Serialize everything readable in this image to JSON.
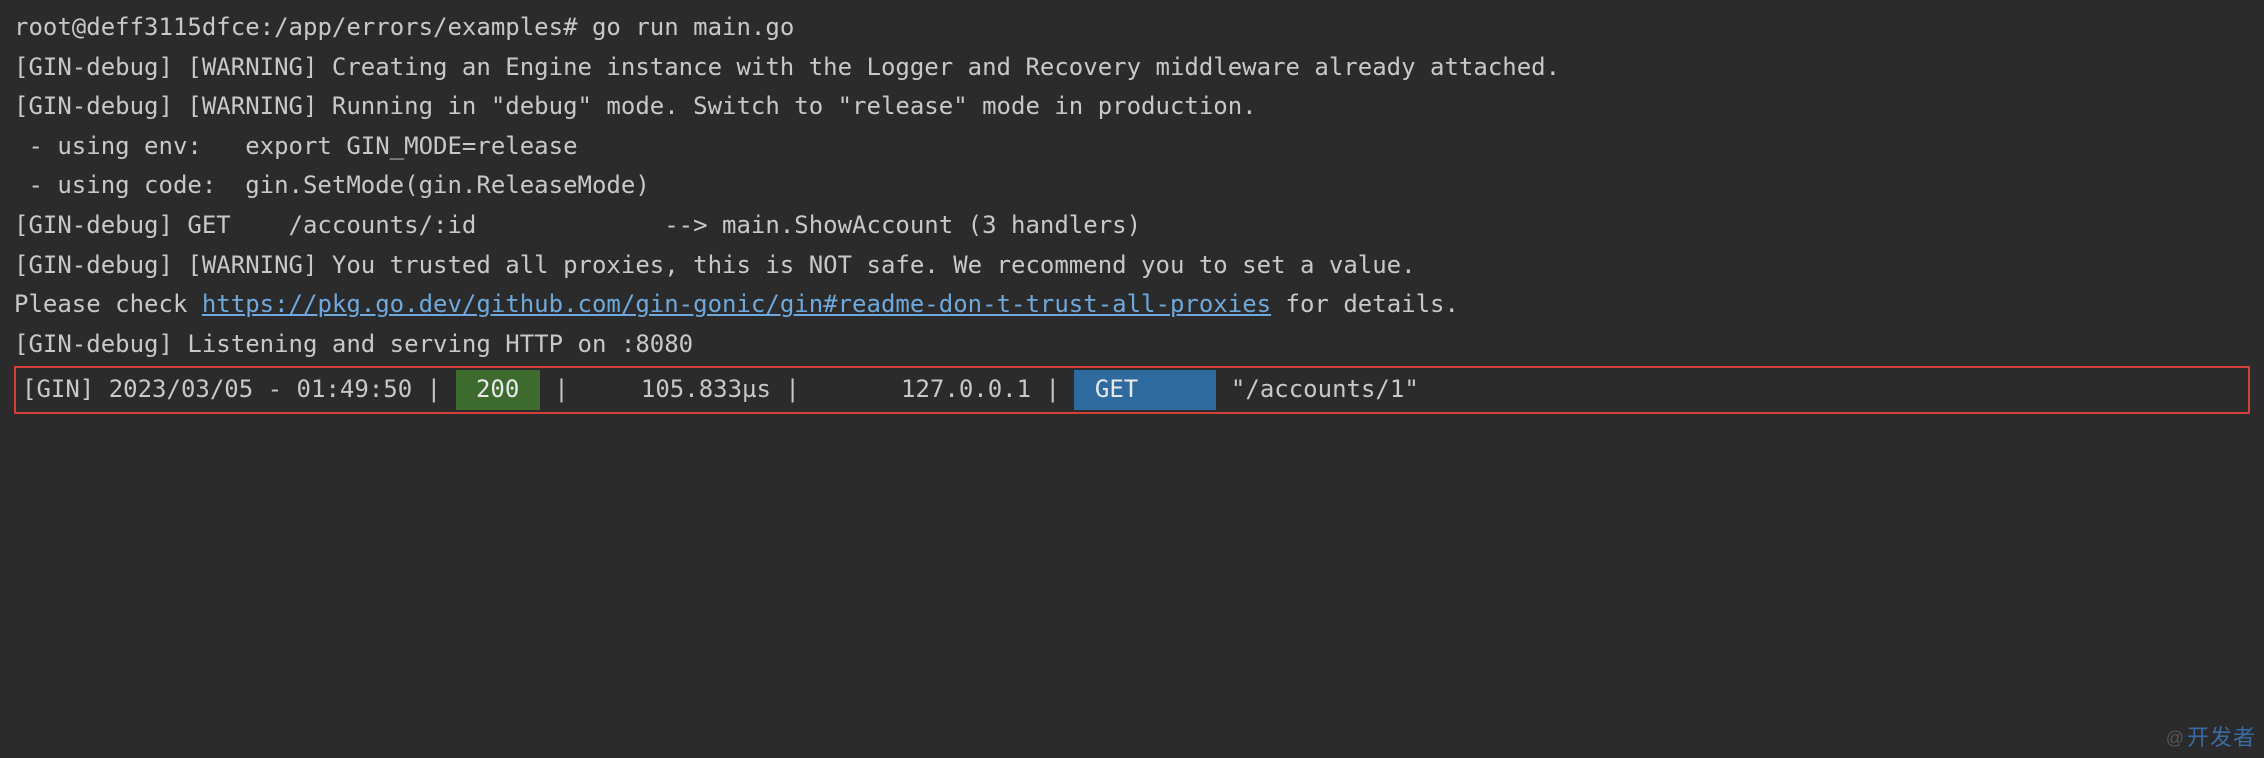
{
  "prompt": {
    "user_host": "root@deff3115dfce",
    "path": "/app/errors/examples",
    "symbol": "#",
    "command": "go run main.go"
  },
  "lines": {
    "warning1": "[GIN-debug] [WARNING] Creating an Engine instance with the Logger and Recovery middleware already attached.",
    "blank1": "",
    "warning2": "[GIN-debug] [WARNING] Running in \"debug\" mode. Switch to \"release\" mode in production.",
    "env_hint": " - using env:   export GIN_MODE=release",
    "code_hint": " - using code:  gin.SetMode(gin.ReleaseMode)",
    "blank2": "",
    "route": "[GIN-debug] GET    /accounts/:id             --> main.ShowAccount (3 handlers)",
    "warning3": "[GIN-debug] [WARNING] You trusted all proxies, this is NOT safe. We recommend you to set a value.",
    "check_pre": "Please check ",
    "check_link": "https://pkg.go.dev/github.com/gin-gonic/gin#readme-don-t-trust-all-proxies",
    "check_post": " for details.",
    "listening": "[GIN-debug] Listening and serving HTTP on :8080"
  },
  "request": {
    "prefix": "[GIN] ",
    "timestamp": "2023/03/05 - 01:49:50",
    "sep": " | ",
    "status": " 200 ",
    "latency_pad": "    ",
    "latency": "105.833µs",
    "ip_pad": "      ",
    "ip": "127.0.0.1",
    "method": " GET     ",
    "path_pad": " ",
    "path": "\"/accounts/1\""
  },
  "watermark": {
    "at": "@",
    "text": "开发者"
  }
}
